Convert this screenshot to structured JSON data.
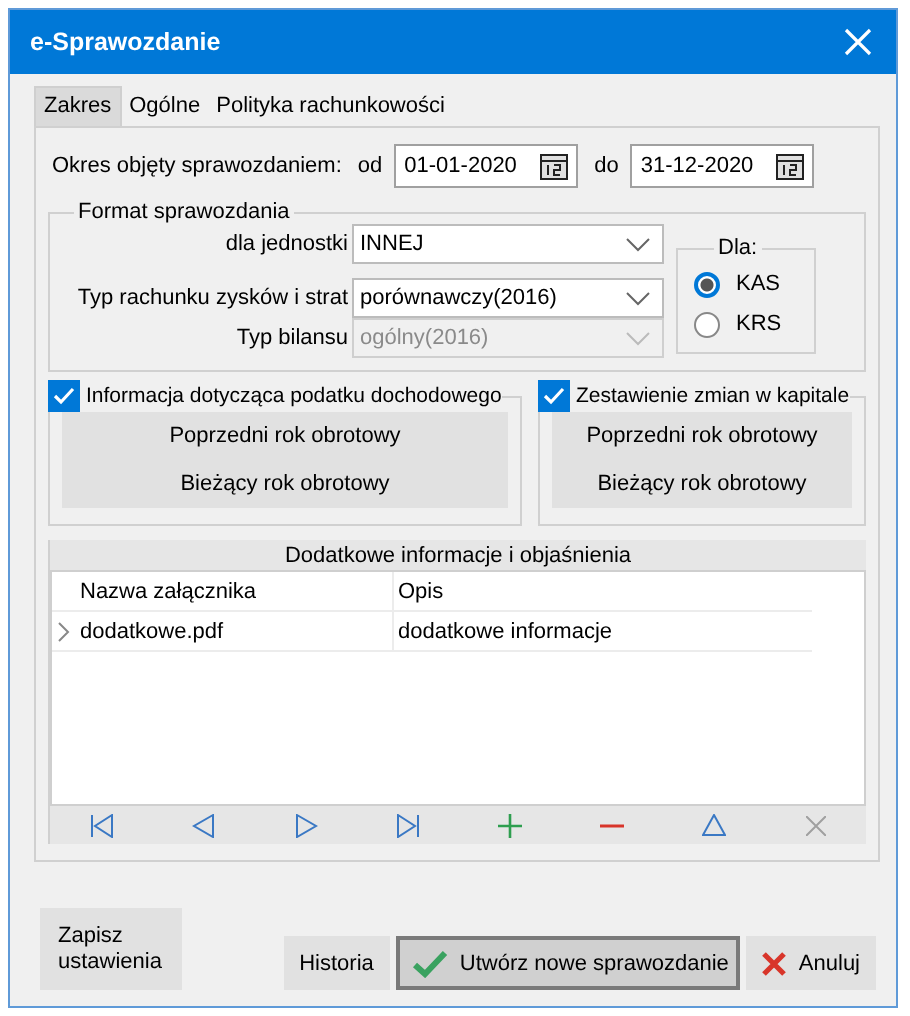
{
  "window": {
    "title": "e-Sprawozdanie"
  },
  "tabs": [
    {
      "label": "Zakres",
      "selected": true
    },
    {
      "label": "Ogólne",
      "selected": false
    },
    {
      "label": "Polityka rachunkowości",
      "selected": false
    }
  ],
  "period": {
    "label": "Okres objęty sprawozdaniem:",
    "from_label": "od",
    "from": "01-01-2020",
    "to_label": "do",
    "to": "31-12-2020"
  },
  "format": {
    "legend": "Format sprawozdania",
    "fields": [
      {
        "label": "dla jednostki",
        "value": "INNEJ",
        "disabled": false
      },
      {
        "label": "Typ rachunku zysków i strat",
        "value": "porównawczy(2016)",
        "disabled": false
      },
      {
        "label": "Typ bilansu",
        "value": "ogólny(2016)",
        "disabled": true
      }
    ],
    "dla": {
      "legend": "Dla:",
      "options": [
        {
          "label": "KAS",
          "selected": true
        },
        {
          "label": "KRS",
          "selected": false
        }
      ]
    }
  },
  "sections": [
    {
      "label": "Informacja dotycząca podatku dochodowego",
      "checked": true,
      "buttons": [
        "Poprzedni rok obrotowy",
        "Bieżący rok obrotowy"
      ]
    },
    {
      "label": "Zestawienie zmian w kapitale",
      "checked": true,
      "buttons": [
        "Poprzedni rok obrotowy",
        "Bieżący rok obrotowy"
      ]
    }
  ],
  "attachments": {
    "title": "Dodatkowe informacje i objaśnienia",
    "columns": [
      "Nazwa załącznika",
      "Opis"
    ],
    "rows": [
      {
        "cells": [
          "dodatkowe.pdf",
          "dodatkowe informacje"
        ],
        "current": true
      }
    ],
    "navigator": [
      {
        "kind": "first",
        "disabled": false
      },
      {
        "kind": "prior",
        "disabled": false
      },
      {
        "kind": "next",
        "disabled": false
      },
      {
        "kind": "last",
        "disabled": false
      },
      {
        "kind": "insert",
        "disabled": false
      },
      {
        "kind": "delete",
        "disabled": false
      },
      {
        "kind": "edit",
        "disabled": false
      },
      {
        "kind": "cancel",
        "disabled": true
      }
    ]
  },
  "save_button": "Zapisz ustawienia",
  "buttons": [
    {
      "label": "Historia",
      "kind": "plain"
    },
    {
      "label": "Utwórz nowe sprawozdanie",
      "kind": "default"
    },
    {
      "label": "Anuluj",
      "kind": "cancel"
    }
  ]
}
